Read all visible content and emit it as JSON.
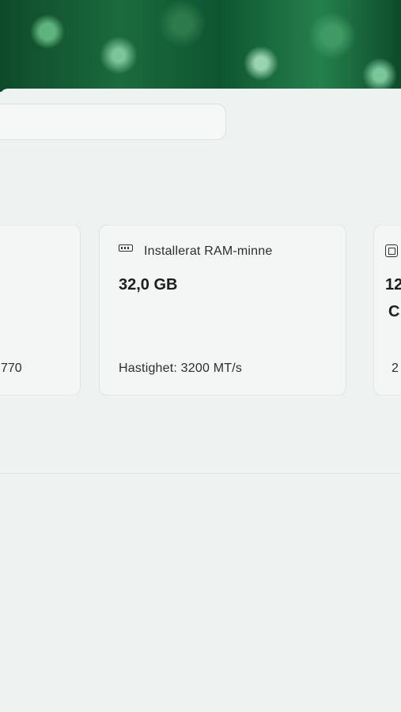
{
  "desktop": {
    "wallpaper": "green-abstract"
  },
  "search": {
    "placeholder": ""
  },
  "cards": {
    "left": {
      "detail": "770"
    },
    "ram": {
      "icon": "ram-icon",
      "title": "Installerat RAM-minne",
      "value": "32,0 GB",
      "detail": "Hastighet: 3200 MT/s"
    },
    "right": {
      "icon": "chip-icon",
      "value": "12",
      "value2": "C",
      "detail": "2"
    }
  }
}
